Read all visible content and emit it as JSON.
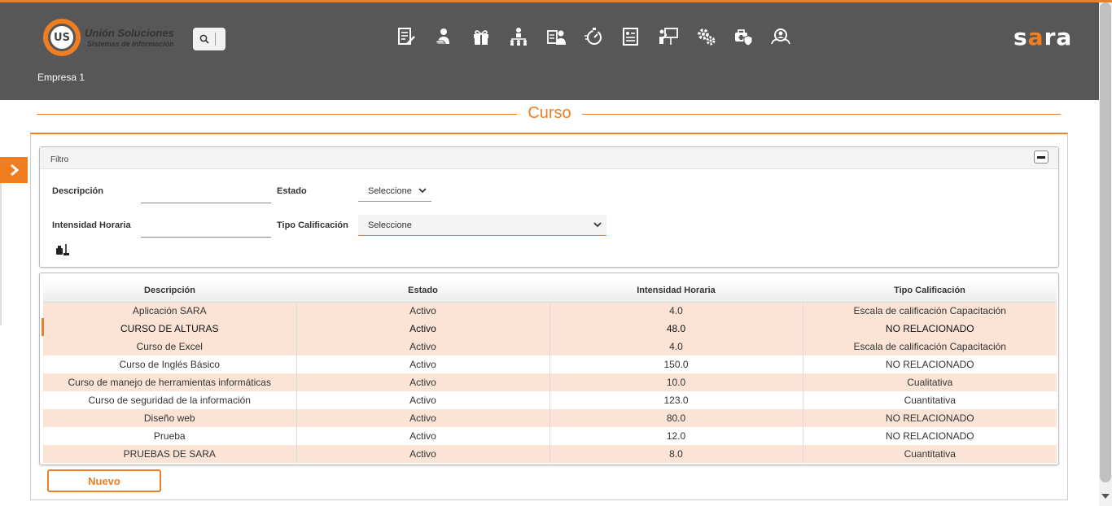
{
  "header": {
    "logo_text": "US",
    "brand_title": "Unión Soluciones",
    "brand_subtitle": "Sistemas de Información",
    "company": "Empresa 1",
    "sara_logo": {
      "s": "s",
      "a": "a",
      "r": "r",
      "a2": "a"
    },
    "nav_icons": [
      "document-edit-icon",
      "person-hand-icon",
      "gift-icon",
      "hierarchy-icon",
      "id-card-icon",
      "timer-icon",
      "report-icon",
      "presentation-icon",
      "gears-icon",
      "medical-shield-icon",
      "people-search-icon"
    ]
  },
  "page": {
    "title": "Curso"
  },
  "filter": {
    "title": "Filtro",
    "descripcion_label": "Descripción",
    "descripcion_value": "",
    "estado_label": "Estado",
    "estado_value": "Seleccione",
    "intensidad_label": "Intensidad Horaria",
    "intensidad_value": "",
    "tipo_label": "Tipo Calificación",
    "tipo_value": "Seleccione"
  },
  "table": {
    "headers": [
      "Descripción",
      "Estado",
      "Intensidad Horaria",
      "Tipo Calificación"
    ],
    "rows": [
      [
        "Aplicación SARA",
        "Activo",
        "4.0",
        "Escala de calificación Capacitación"
      ],
      [
        "CURSO DE ALTURAS",
        "Activo",
        "48.0",
        "NO RELACIONADO"
      ],
      [
        "Curso de Excel",
        "Activo",
        "4.0",
        "Escala de calificación Capacitación"
      ],
      [
        "Curso de Inglés Básico",
        "Activo",
        "150.0",
        "NO RELACIONADO"
      ],
      [
        "Curso de manejo de herramientas informáticas",
        "Activo",
        "10.0",
        "Cualitativa"
      ],
      [
        "Curso de seguridad de la información",
        "Activo",
        "123.0",
        "Cuantitativa"
      ],
      [
        "Diseño web",
        "Activo",
        "80.0",
        "NO RELACIONADO"
      ],
      [
        "Prueba",
        "Activo",
        "12.0",
        "NO RELACIONADO"
      ],
      [
        "PRUEBAS DE SARA",
        "Activo",
        "8.0",
        "Cuantitativa"
      ]
    ]
  },
  "actions": {
    "nuevo_label": "Nuevo"
  },
  "colors": {
    "accent": "#ef7d22",
    "header_bg": "#575757",
    "row_alt": "#fbe4d5"
  }
}
